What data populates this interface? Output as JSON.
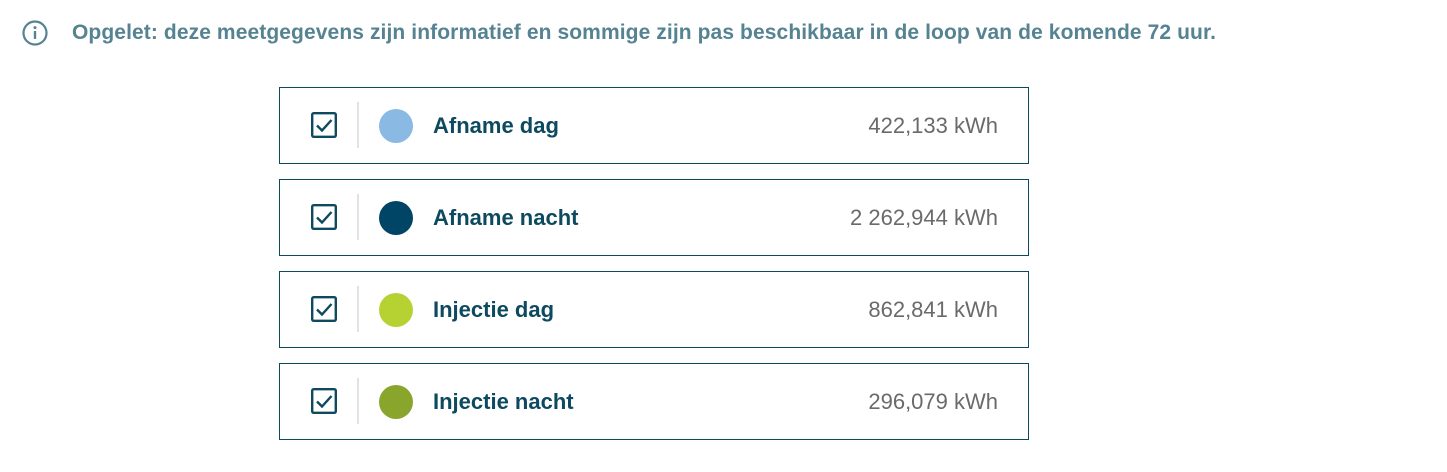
{
  "notice": {
    "icon": "info-icon",
    "text": "Opgelet: deze meetgegevens zijn informatief en sommige zijn pas beschikbaar in de loop van de komende 72 uur."
  },
  "colors": {
    "border": "#0e4a5e",
    "label": "#0d4a5f",
    "notice": "#558391",
    "value": "#6a6a6a"
  },
  "legend": {
    "items": [
      {
        "label": "Afname dag",
        "value": "422,133 kWh",
        "color": "#8ab9e3",
        "checked": true
      },
      {
        "label": "Afname nacht",
        "value": "2 262,944 kWh",
        "color": "#004466",
        "checked": true
      },
      {
        "label": "Injectie dag",
        "value": "862,841 kWh",
        "color": "#b6d232",
        "checked": true
      },
      {
        "label": "Injectie nacht",
        "value": "296,079 kWh",
        "color": "#8aa52b",
        "checked": true
      }
    ]
  }
}
